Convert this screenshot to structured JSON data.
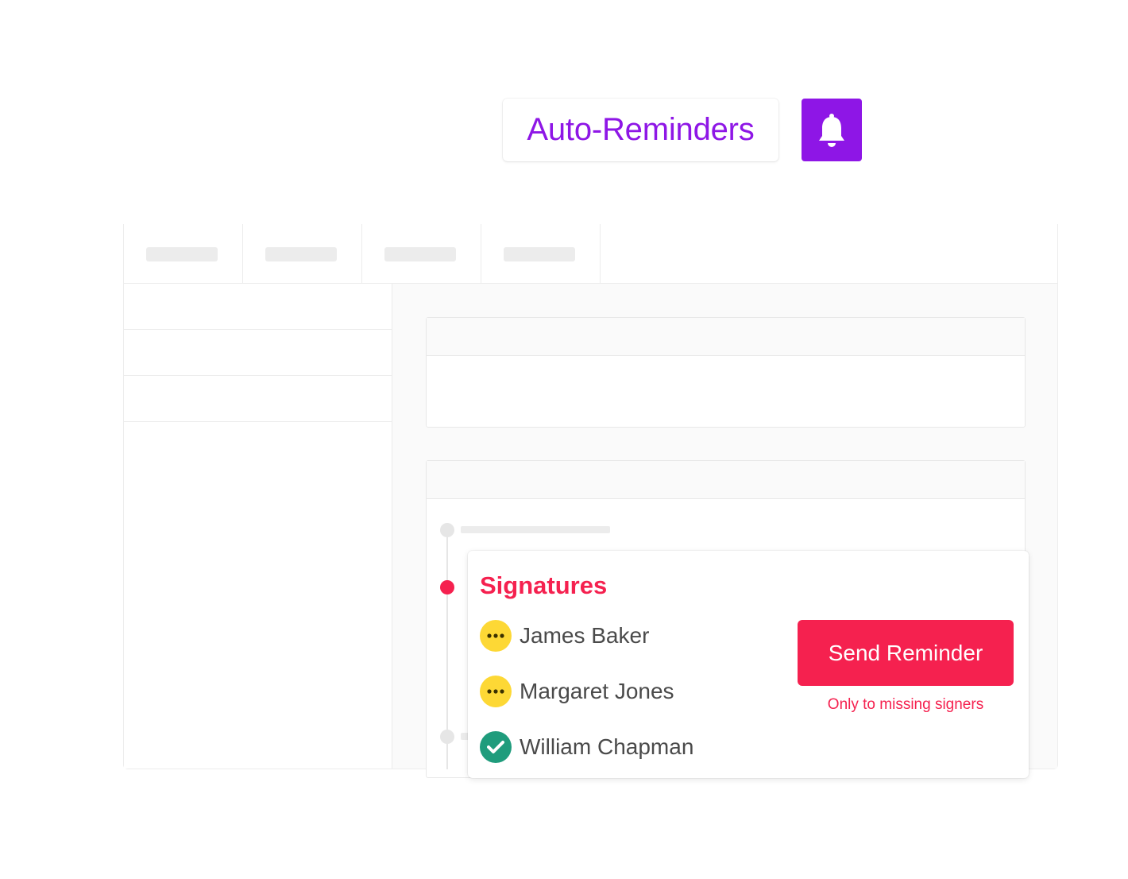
{
  "header": {
    "title": "Auto-Reminders",
    "icon": "bell-icon",
    "accent_color": "#8e16e6"
  },
  "signatures": {
    "title": "Signatures",
    "accent_color": "#f5214f",
    "signers": [
      {
        "name": "James Baker",
        "status": "pending",
        "icon": "ellipsis-icon",
        "color": "#fdd835"
      },
      {
        "name": "Margaret Jones",
        "status": "pending",
        "icon": "ellipsis-icon",
        "color": "#fdd835"
      },
      {
        "name": "William Chapman",
        "status": "signed",
        "icon": "check-icon",
        "color": "#1f9c7c"
      }
    ],
    "send_button_label": "Send Reminder",
    "send_note": "Only to missing signers"
  }
}
